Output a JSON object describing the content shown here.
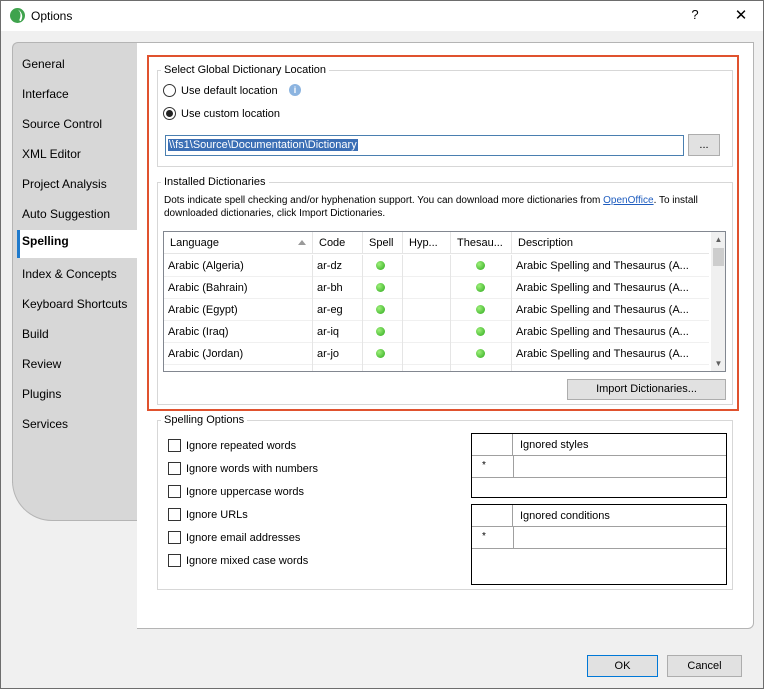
{
  "window": {
    "title": "Options",
    "help_label": "?",
    "close_label": "✕"
  },
  "nav": {
    "items": [
      "General",
      "Interface",
      "Source Control",
      "XML Editor",
      "Project Analysis",
      "Auto Suggestion",
      "Spelling",
      "Index & Concepts",
      "Keyboard Shortcuts",
      "Build",
      "Review",
      "Plugins",
      "Services"
    ],
    "selected": "Spelling"
  },
  "dictionary_location": {
    "group_label": "Select Global Dictionary Location",
    "option_default": "Use default location",
    "option_custom": "Use custom location",
    "selected_option": "custom",
    "path_value": "\\\\fs1\\Source\\Documentation\\Dictionary",
    "browse_label": "..."
  },
  "installed": {
    "group_label": "Installed Dictionaries",
    "description_prefix": "Dots indicate spell checking and/or hyphenation support. You can download more dictionaries from ",
    "description_link": "OpenOffice",
    "description_suffix": ". To install downloaded dictionaries, click Import Dictionaries.",
    "columns": [
      "Language",
      "Code",
      "Spell",
      "Hyp...",
      "Thesau...",
      "Description"
    ],
    "rows": [
      {
        "language": "Arabic (Algeria)",
        "code": "ar-dz",
        "spell": true,
        "hyph": false,
        "thesaurus": true,
        "description": "Arabic Spelling and Thesaurus (A..."
      },
      {
        "language": "Arabic (Bahrain)",
        "code": "ar-bh",
        "spell": true,
        "hyph": false,
        "thesaurus": true,
        "description": "Arabic Spelling and Thesaurus (A..."
      },
      {
        "language": "Arabic (Egypt)",
        "code": "ar-eg",
        "spell": true,
        "hyph": false,
        "thesaurus": true,
        "description": "Arabic Spelling and Thesaurus (A..."
      },
      {
        "language": "Arabic (Iraq)",
        "code": "ar-iq",
        "spell": true,
        "hyph": false,
        "thesaurus": true,
        "description": "Arabic Spelling and Thesaurus (A..."
      },
      {
        "language": "Arabic (Jordan)",
        "code": "ar-jo",
        "spell": true,
        "hyph": false,
        "thesaurus": true,
        "description": "Arabic Spelling and Thesaurus (A..."
      }
    ],
    "import_label": "Import Dictionaries..."
  },
  "spelling_options": {
    "group_label": "Spelling Options",
    "checkboxes": [
      "Ignore repeated words",
      "Ignore words with numbers",
      "Ignore uppercase words",
      "Ignore URLs",
      "Ignore email addresses",
      "Ignore mixed case words"
    ],
    "ignored_styles_title": "Ignored styles",
    "ignored_conditions_title": "Ignored conditions",
    "new_row_marker": "*"
  },
  "footer": {
    "ok_label": "OK",
    "cancel_label": "Cancel"
  },
  "colors": {
    "highlight": "#e0522e",
    "accent": "#1f7acc",
    "dot": "#2da91d",
    "selection": "#3b6fb5"
  }
}
